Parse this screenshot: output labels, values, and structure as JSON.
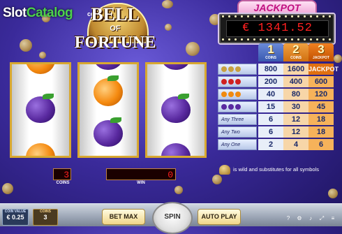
{
  "brand": {
    "prefix": "Slot",
    "suffix": "Catalog",
    "logo_prefix": "com"
  },
  "game_logo": {
    "line1": "BELL",
    "line2": "OF",
    "line3": "FORTUNE"
  },
  "jackpot": {
    "banner": "JACKPOT",
    "value": "€ 1341.52"
  },
  "reels": [
    [
      "orange",
      "plum",
      "orange"
    ],
    [
      "plum-leaf",
      "orange",
      "plum"
    ],
    [
      "plum-leaf",
      "plum",
      "plum"
    ]
  ],
  "paytable": {
    "headers": [
      {
        "n": "1",
        "c": "COINS"
      },
      {
        "n": "2",
        "c": "COINS"
      },
      {
        "n": "3",
        "c": "JACKPOT"
      }
    ],
    "rows": [
      {
        "symbol": "bell-bell-bell",
        "label": "",
        "v1": "800",
        "v2": "1600",
        "v3": "JACKPOT"
      },
      {
        "symbol": "cherry-cherry-cherry",
        "label": "",
        "v1": "200",
        "v2": "400",
        "v3": "600"
      },
      {
        "symbol": "orange-orange-orange",
        "label": "",
        "v1": "40",
        "v2": "80",
        "v3": "120"
      },
      {
        "symbol": "plum-plum-plum",
        "label": "",
        "v1": "15",
        "v2": "30",
        "v3": "45"
      },
      {
        "symbol": "any",
        "label": "Any Three",
        "v1": "6",
        "v2": "12",
        "v3": "18"
      },
      {
        "symbol": "any",
        "label": "Any Two",
        "v1": "6",
        "v2": "12",
        "v3": "18"
      },
      {
        "symbol": "any",
        "label": "Any One",
        "v1": "2",
        "v2": "4",
        "v3": "6"
      }
    ]
  },
  "wild_note": "is wild and substitutes for all symbols",
  "counters": {
    "coins_value": "3",
    "coins_label": "COINS",
    "win_value": "0",
    "win_label": "WIN"
  },
  "bottom": {
    "coin_value_label": "COIN VALUE",
    "coin_value": "€ 0.25",
    "coins_label": "COINS",
    "coins_value": "3",
    "bet_max": "BET MAX",
    "spin": "SPIN",
    "auto_play": "AUTO PLAY"
  },
  "colors": {
    "accent_red": "#ff2020",
    "jackpot_pink": "#c01080",
    "reel_frame": "#d8a830"
  }
}
